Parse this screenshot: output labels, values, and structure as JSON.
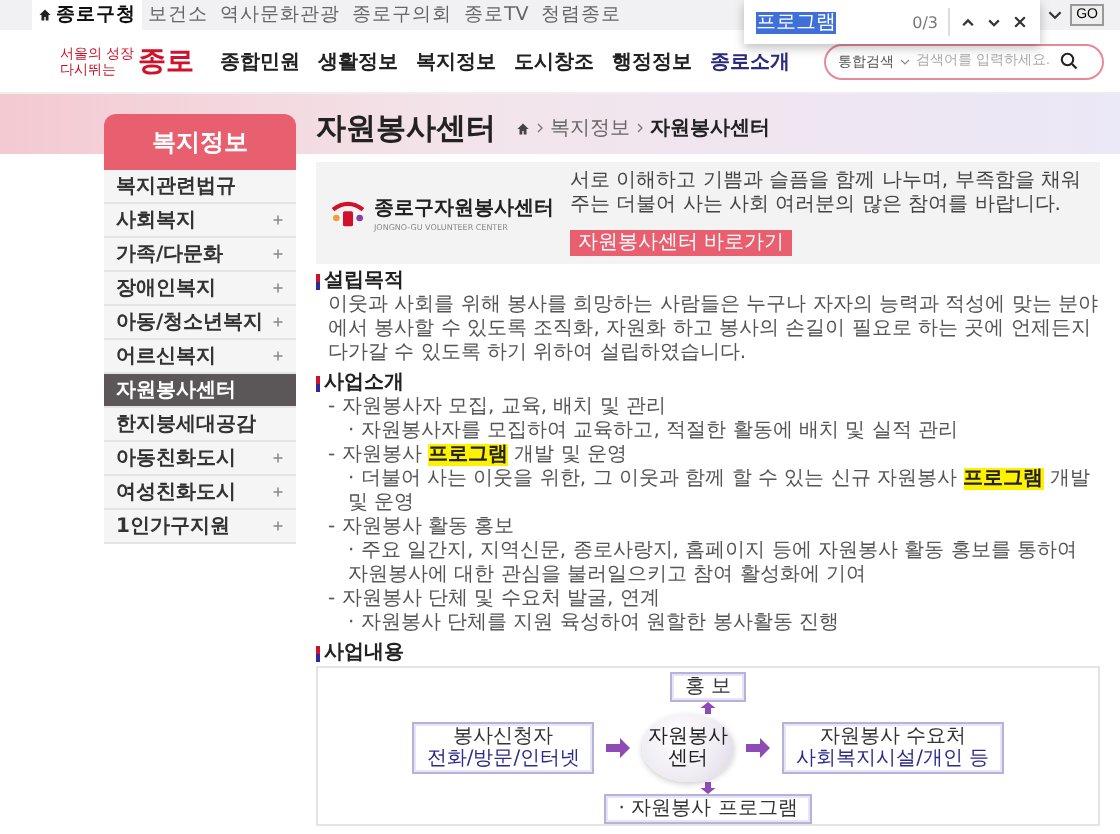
{
  "top_links": [
    {
      "label": "종로구청",
      "selected": true
    },
    {
      "label": "보건소",
      "selected": false
    },
    {
      "label": "역사문화관광",
      "selected": false
    },
    {
      "label": "종로구의회",
      "selected": false
    },
    {
      "label": "종로TV",
      "selected": false
    },
    {
      "label": "청렴종로",
      "selected": false
    }
  ],
  "go_button": "GO",
  "find_bar": {
    "value": "프로그램",
    "count": "0/3"
  },
  "logo": {
    "line1": "서울의 성장",
    "line2": "다시뛰는",
    "name": "종로"
  },
  "nav": [
    {
      "label": "종합민원",
      "highlighted": false
    },
    {
      "label": "생활정보",
      "highlighted": false
    },
    {
      "label": "복지정보",
      "highlighted": false
    },
    {
      "label": "도시창조",
      "highlighted": false
    },
    {
      "label": "행정정보",
      "highlighted": false
    },
    {
      "label": "종로소개",
      "highlighted": true
    }
  ],
  "search": {
    "scope": "통합검색",
    "placeholder": "검색어를 입력하세요."
  },
  "sidebar": {
    "title": "복지정보",
    "items": [
      {
        "label": "복지관련법규",
        "expandable": false,
        "selected": false
      },
      {
        "label": "사회복지",
        "expandable": true,
        "selected": false
      },
      {
        "label": "가족/다문화",
        "expandable": true,
        "selected": false
      },
      {
        "label": "장애인복지",
        "expandable": true,
        "selected": false
      },
      {
        "label": "아동/청소년복지",
        "expandable": true,
        "selected": false
      },
      {
        "label": "어르신복지",
        "expandable": true,
        "selected": false
      },
      {
        "label": "자원봉사센터",
        "expandable": false,
        "selected": true
      },
      {
        "label": "한지붕세대공감",
        "expandable": false,
        "selected": false
      },
      {
        "label": "아동친화도시",
        "expandable": true,
        "selected": false
      },
      {
        "label": "여성친화도시",
        "expandable": true,
        "selected": false
      },
      {
        "label": "1인가구지원",
        "expandable": true,
        "selected": false
      }
    ]
  },
  "page": {
    "title": "자원봉사센터",
    "breadcrumb": [
      "복지정보",
      "자원봉사센터"
    ]
  },
  "banner": {
    "org_name": "종로구자원봉사센터",
    "org_subtitle": "JONGNO-GU VOLUNTEER CENTER",
    "description": "서로 이해하고 기쁨과 슬픔을 함께 나누며, 부족함을 채워주는 더불어 사는 사회 여러분의 많은 참여를 바랍니다.",
    "button": "자원봉사센터 바로가기"
  },
  "sections": [
    {
      "kind": "paragraph",
      "heading": "설립목적",
      "text": "이웃과 사회를 위해 봉사를 희망하는 사람들은 누구나 자자의 능력과 적성에 맞는 분야에서 봉사할 수 있도록 조직화, 자원화 하고 봉사의 손길이 필요로 하는 곳에 언제든지 다가갈 수 있도록 하기 위하여 설립하였습니다."
    },
    {
      "kind": "list",
      "heading": "사업소개",
      "items": [
        {
          "parts": [
            {
              "text": "- 자원봉사자 모집, 교육, 배치 및 관리",
              "highlighted": false
            }
          ],
          "children": [
            {
              "parts": [
                {
                  "text": "· 자원봉사자를 모집하여 교육하고, 적절한 활동에 배치 및 실적 관리",
                  "highlighted": false
                }
              ]
            }
          ]
        },
        {
          "parts": [
            {
              "text": "- 자원봉사 ",
              "highlighted": false
            },
            {
              "text": "프로그램",
              "highlighted": true
            },
            {
              "text": " 개발 및 운영",
              "highlighted": false
            }
          ],
          "children": [
            {
              "parts": [
                {
                  "text": "· 더불어 사는 이웃을 위한, 그 이웃과 함께 할 수 있는 신규 자원봉사 ",
                  "highlighted": false
                },
                {
                  "text": "프로그램",
                  "highlighted": true
                },
                {
                  "text": " 개발 및 운영",
                  "highlighted": false
                }
              ]
            }
          ]
        },
        {
          "parts": [
            {
              "text": "- 자원봉사 활동 홍보",
              "highlighted": false
            }
          ],
          "children": [
            {
              "parts": [
                {
                  "text": "· 주요 일간지, 지역신문, 종로사랑지, 홈페이지 등에 자원봉사 활동 홍보를 통하여 자원봉사에 대한 관심을 불러일으키고 참여 활성화에 기여",
                  "highlighted": false
                }
              ]
            }
          ]
        },
        {
          "parts": [
            {
              "text": "- 자원봉사 단체 및 수요처 발굴, 연계",
              "highlighted": false
            }
          ],
          "children": [
            {
              "parts": [
                {
                  "text": "· 자원봉사 단체를 지원 육성하여 원할한 봉사활동 진행",
                  "highlighted": false
                }
              ]
            }
          ]
        }
      ]
    },
    {
      "kind": "diagram",
      "heading": "사업내용",
      "top": [
        "홍 보"
      ],
      "left": [
        "봉사신청자",
        "전화/방문/인터넷"
      ],
      "center": "자원봉사센터",
      "right": [
        "자원봉사 수요처",
        "사회복지시설/개인 등"
      ],
      "bottom": [
        "· 자원봉사 프로그램"
      ]
    }
  ]
}
